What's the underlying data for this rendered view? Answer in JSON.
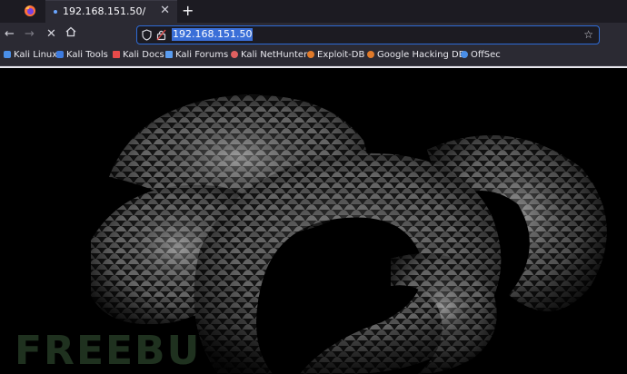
{
  "browser": {
    "tab": {
      "title": "192.168.151.50/"
    },
    "url": "192.168.151.50",
    "bookmarks": [
      {
        "label": "Kali Linux",
        "icon": "kali-dragon-icon",
        "color": "#4a8fe8"
      },
      {
        "label": "Kali Tools",
        "icon": "kali-tools-icon",
        "color": "#3d7be0"
      },
      {
        "label": "Kali Docs",
        "icon": "kali-docs-icon",
        "color": "#e84a4a"
      },
      {
        "label": "Kali Forums",
        "icon": "kali-forums-icon",
        "color": "#5a9cf0"
      },
      {
        "label": "Kali NetHunter",
        "icon": "nethunter-icon",
        "color": "#e06060"
      },
      {
        "label": "Exploit-DB",
        "icon": "exploit-db-icon",
        "color": "#e07a2a"
      },
      {
        "label": "Google Hacking DB",
        "icon": "ghdb-icon",
        "color": "#e07a2a"
      },
      {
        "label": "OffSec",
        "icon": "offsec-icon",
        "color": "#4a8fe8"
      }
    ]
  },
  "page": {
    "image": "coiled-black-snake-image",
    "watermark": "FREEBU"
  },
  "colors": {
    "tab_bar": "#1c1b22",
    "toolbar": "#2b2a33",
    "url_highlight": "#3a6fd8",
    "url_border": "#2e6bd6"
  }
}
